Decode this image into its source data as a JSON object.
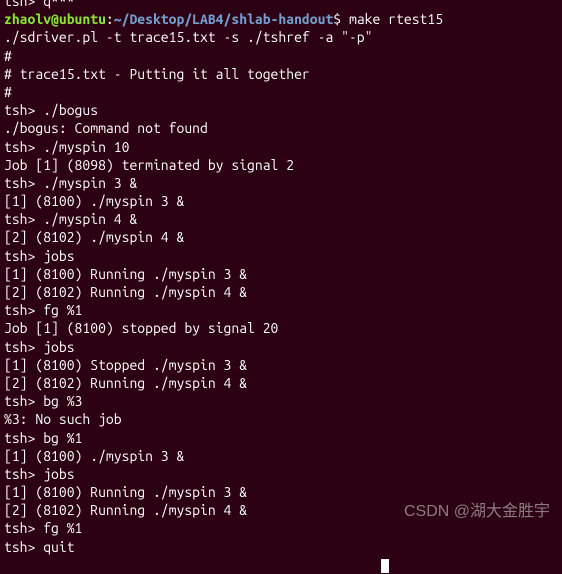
{
  "prompt": {
    "partial_top": "tsh> q***",
    "user": "zhaolv@ubuntu",
    "colon": ":",
    "path": "~/Desktop/LAB4/shlab-handout",
    "dollar": "$ ",
    "command": "make rtest15"
  },
  "lines": [
    "./sdriver.pl -t trace15.txt -s ./tshref -a \"-p\"",
    "#",
    "# trace15.txt - Putting it all together",
    "#",
    "tsh> ./bogus",
    "./bogus: Command not found",
    "tsh> ./myspin 10",
    "Job [1] (8098) terminated by signal 2",
    "tsh> ./myspin 3 &",
    "[1] (8100) ./myspin 3 &",
    "tsh> ./myspin 4 &",
    "[2] (8102) ./myspin 4 &",
    "tsh> jobs",
    "[1] (8100) Running ./myspin 3 &",
    "[2] (8102) Running ./myspin 4 &",
    "tsh> fg %1",
    "Job [1] (8100) stopped by signal 20",
    "tsh> jobs",
    "[1] (8100) Stopped ./myspin 3 &",
    "[2] (8102) Running ./myspin 4 &",
    "tsh> bg %3",
    "%3: No such job",
    "tsh> bg %1",
    "[1] (8100) ./myspin 3 &",
    "tsh> jobs",
    "[1] (8100) Running ./myspin 3 &",
    "[2] (8102) Running ./myspin 4 &",
    "tsh> fg %1",
    "tsh> quit"
  ],
  "watermark": "CSDN @湖大金胜宇"
}
